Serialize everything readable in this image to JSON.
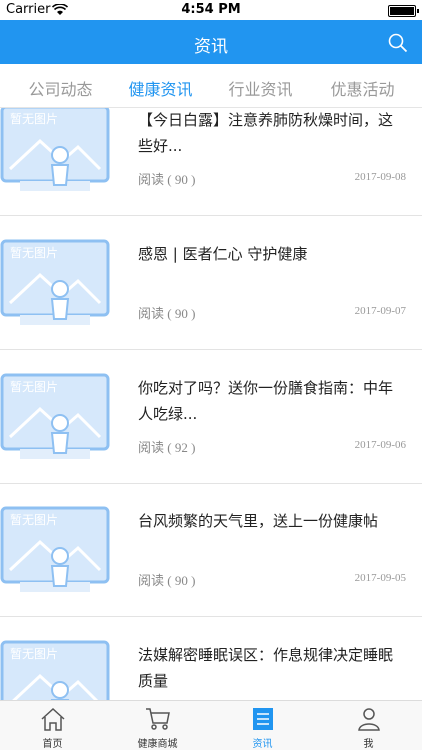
{
  "status": {
    "carrier": "Carrier",
    "time": "4:54 PM"
  },
  "nav": {
    "title": "资讯"
  },
  "tabs": [
    {
      "label": "公司动态"
    },
    {
      "label": "健康资讯"
    },
    {
      "label": "行业资讯"
    },
    {
      "label": "优惠活动"
    }
  ],
  "placeholder_text": "暂无图片",
  "articles": [
    {
      "title": "【今日白露】注意养肺防秋燥时间，这些好...",
      "reads": "阅读 ( 90 )",
      "date": "2017-09-08"
    },
    {
      "title": "感恩 | 医者仁心 守护健康",
      "reads": "阅读 ( 90 )",
      "date": "2017-09-07"
    },
    {
      "title": "你吃对了吗？送你一份膳食指南：中年人吃绿...",
      "reads": "阅读 ( 92 )",
      "date": "2017-09-06"
    },
    {
      "title": "台风频繁的天气里，送上一份健康帖",
      "reads": "阅读 ( 90 )",
      "date": "2017-09-05"
    },
    {
      "title": "法媒解密睡眠误区：作息规律决定睡眠质量",
      "reads": "",
      "date": ""
    }
  ],
  "tabbar": [
    {
      "label": "首页",
      "icon": "home-icon"
    },
    {
      "label": "健康商城",
      "icon": "cart-icon"
    },
    {
      "label": "资讯",
      "icon": "news-icon"
    },
    {
      "label": "我",
      "icon": "person-icon"
    }
  ],
  "colors": {
    "accent": "#2195f0"
  }
}
